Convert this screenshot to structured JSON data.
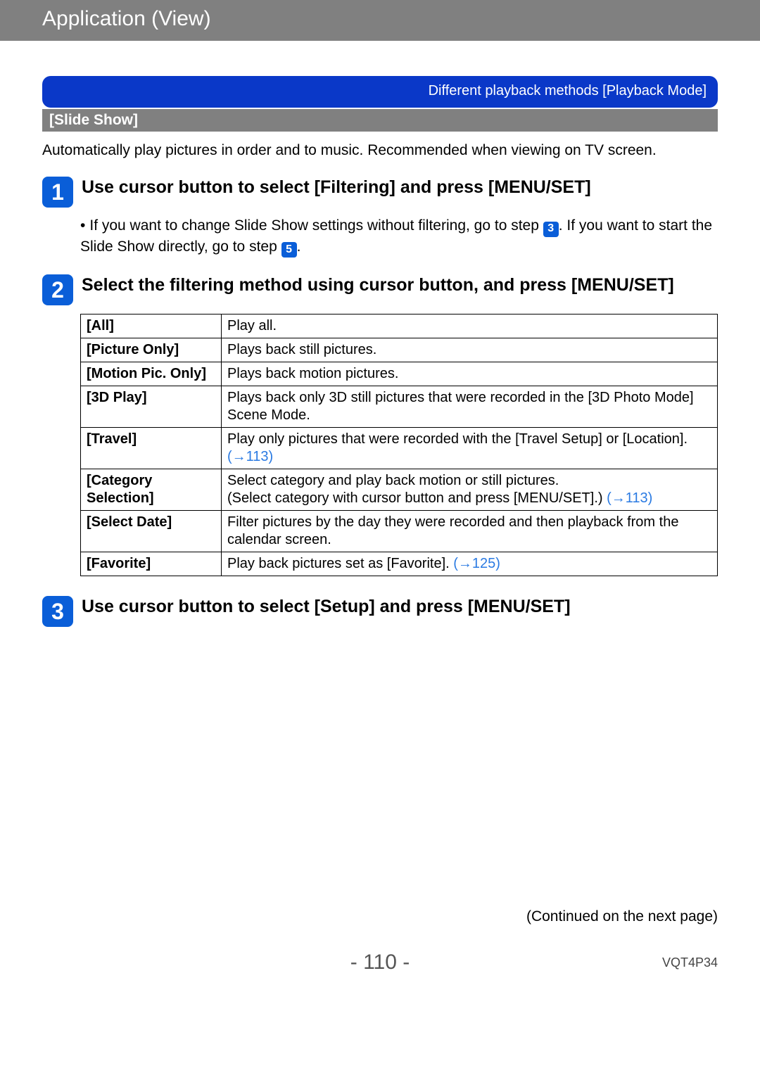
{
  "header": {
    "title": "Application (View)"
  },
  "banner": {
    "text": "Different playback methods  [Playback Mode]"
  },
  "subbar": {
    "text": "[Slide Show]"
  },
  "intro": "Automatically play pictures in order and to music. Recommended when viewing on TV screen.",
  "steps": {
    "s1": {
      "num": "1",
      "title": "Use cursor button to select [Filtering] and press [MENU/SET]",
      "bullet_pre": "If you want to change Slide Show settings without filtering, go to step ",
      "bullet_badge1": "3",
      "bullet_mid": ". If you want to start the Slide Show directly, go to step ",
      "bullet_badge2": "5",
      "bullet_post": "."
    },
    "s2": {
      "num": "2",
      "title": "Select the filtering method using cursor button, and press [MENU/SET]"
    },
    "s3": {
      "num": "3",
      "title": "Use cursor button to select [Setup] and press [MENU/SET]"
    }
  },
  "table": [
    {
      "k": "[All]",
      "v": "Play all."
    },
    {
      "k": "[Picture Only]",
      "v": "Plays back still pictures."
    },
    {
      "k": "[Motion Pic. Only]",
      "v": "Plays back motion pictures."
    },
    {
      "k": "[3D Play]",
      "v": "Plays back only 3D still pictures that were recorded in the [3D Photo Mode] Scene Mode."
    },
    {
      "k": "[Travel]",
      "v_pre": "Play only pictures that were recorded with the [Travel Setup] or [Location]. ",
      "link": "(→113)"
    },
    {
      "k": "[Category Selection]",
      "v_pre": "Select category and play back motion or still pictures.\n(Select category with cursor button and press [MENU/SET].) ",
      "link": "(→113)"
    },
    {
      "k": "[Select Date]",
      "v": "Filter pictures by the day they were recorded and then playback from the calendar screen."
    },
    {
      "k": "[Favorite]",
      "v_pre": "Play back pictures set as [Favorite]. ",
      "link": "(→125)"
    }
  ],
  "footer": {
    "note": "(Continued on the next page)",
    "page": "- 110 -",
    "docid": "VQT4P34"
  }
}
